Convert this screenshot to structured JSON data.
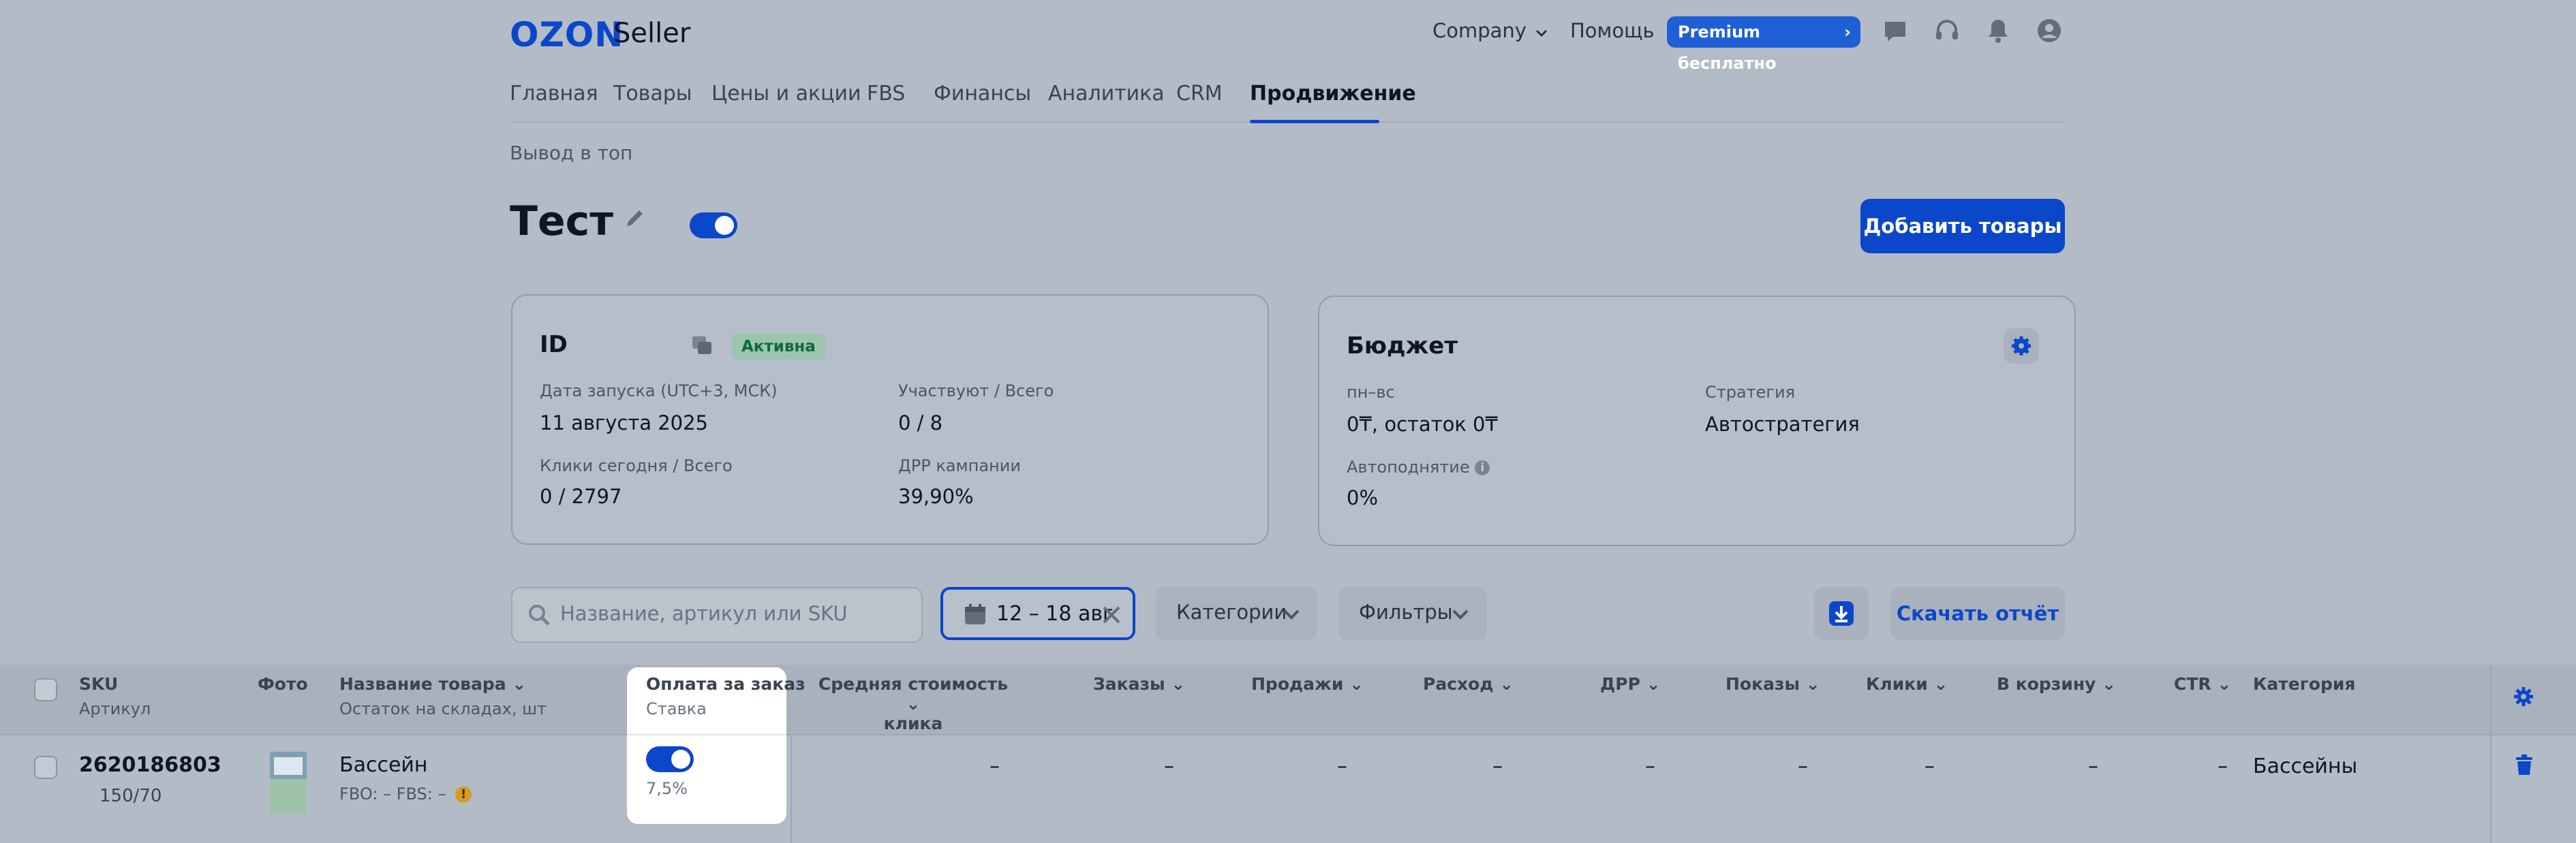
{
  "header": {
    "logo": "OZON",
    "logo_suffix": "Seller",
    "company": "Company",
    "help": "Помощь",
    "premium": "Premium бесплатно"
  },
  "nav": {
    "tabs": [
      "Главная",
      "Товары",
      "Цены и акции",
      "FBS",
      "Финансы",
      "Аналитика",
      "CRM",
      "Продвижение"
    ],
    "active": "Продвижение"
  },
  "breadcrumb": "Вывод в топ",
  "page": {
    "title": "Тест",
    "add_button": "Добавить товары"
  },
  "info_card": {
    "title": "ID",
    "status": "Активна",
    "launch_label": "Дата запуска (UTC+3, МСК)",
    "launch_value": "11 августа 2025",
    "participate_label": "Участвуют / Всего",
    "participate_value": "0 / 8",
    "clicks_label": "Клики сегодня / Всего",
    "clicks_value": "0 / 2797",
    "drr_label": "ДРР кампании",
    "drr_value": "39,90%"
  },
  "budget_card": {
    "title": "Бюджет",
    "period_label": "пн–вс",
    "period_value": "0₸, остаток 0₸",
    "strategy_label": "Стратегия",
    "strategy_value": "Автостратегия",
    "autoraise_label": "Автоподнятие",
    "autoraise_value": "0%"
  },
  "toolbar": {
    "search_placeholder": "Название, артикул или SKU",
    "date_range": "12 – 18 авг",
    "categories": "Категории",
    "filters": "Фильтры",
    "download_report": "Скачать отчёт"
  },
  "table": {
    "columns": {
      "sku": "SKU",
      "sku_sub": "Артикул",
      "photo": "Фото",
      "name": "Название товара",
      "name_sub": "Остаток на складах, шт",
      "pay": "Оплата за заказ",
      "pay_sub": "Ставка",
      "avg_click_1": "Средняя стоимость",
      "avg_click_2": "клика",
      "orders": "Заказы",
      "sales": "Продажи",
      "spend": "Расход",
      "drr": "ДРР",
      "impressions": "Показы",
      "clicks": "Клики",
      "cart": "В корзину",
      "ctr": "CTR",
      "category": "Категория"
    },
    "row": {
      "sku": "2620186803",
      "article": "150/70",
      "name": "Бассейн",
      "stock": "FBO: –   FBS: –",
      "rate": "7,5%",
      "dash": "–",
      "category": "Бассейны"
    }
  }
}
